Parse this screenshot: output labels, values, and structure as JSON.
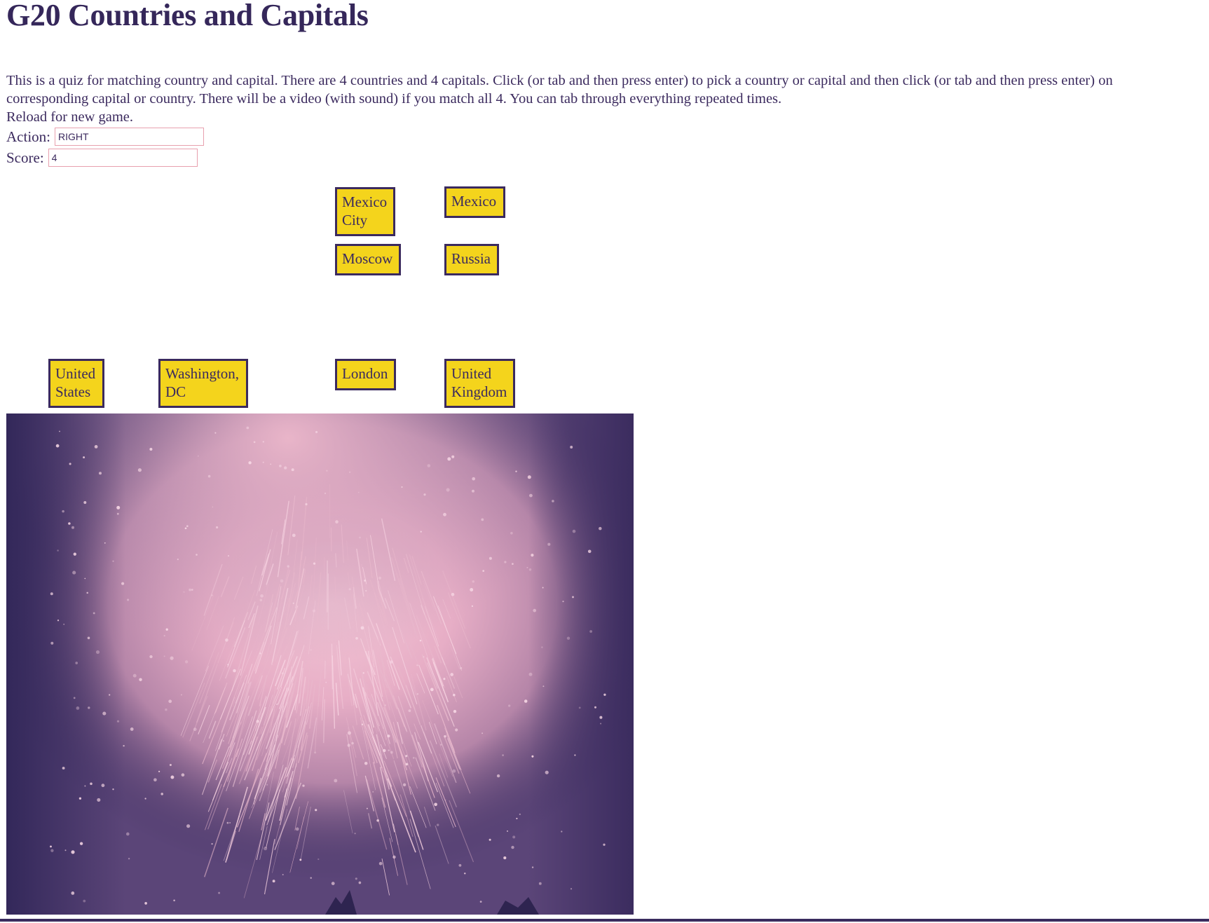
{
  "page": {
    "title": "G20 Countries and Capitals",
    "instructions": "This is a quiz for matching country and capital. There are 4 countries and 4 capitals. Click (or tab and then press enter) to pick a country or capital and then click (or tab and then press enter) on corresponding capital or country. There will be a video (with sound) if you match all 4. You can tab through everything repeated times.",
    "reload_note": "Reload for new game."
  },
  "status": {
    "action_label": "Action:",
    "action_value": "RIGHT",
    "score_label": "Score:",
    "score_value": "4"
  },
  "cards": [
    {
      "label": "Mexico City",
      "kind": "capital"
    },
    {
      "label": "Mexico",
      "kind": "country"
    },
    {
      "label": "Moscow",
      "kind": "capital"
    },
    {
      "label": "Russia",
      "kind": "country"
    },
    {
      "label": "United States",
      "kind": "country"
    },
    {
      "label": "Washington, DC",
      "kind": "capital"
    },
    {
      "label": "London",
      "kind": "capital"
    },
    {
      "label": "United Kingdom",
      "kind": "country"
    }
  ],
  "colors": {
    "card_fill": "#f4d41c",
    "card_border": "#3b2a5e",
    "text": "#3b2a5e",
    "video_dark": "#3a2b5e",
    "video_glow": "#f1bfd0"
  }
}
